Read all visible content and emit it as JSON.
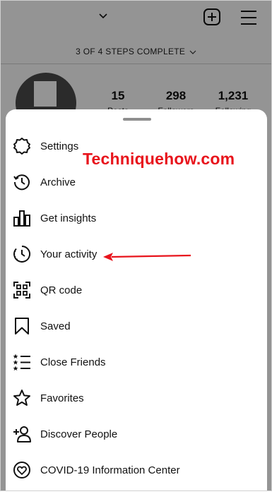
{
  "header": {
    "steps_text": "3 OF 4 STEPS COMPLETE"
  },
  "profile": {
    "stats": [
      {
        "value": "15",
        "label": "Posts"
      },
      {
        "value": "298",
        "label": "Followers"
      },
      {
        "value": "1,231",
        "label": "Following"
      }
    ]
  },
  "menu": {
    "items": [
      {
        "label": "Settings",
        "icon": "settings-gear-icon"
      },
      {
        "label": "Archive",
        "icon": "archive-clock-icon"
      },
      {
        "label": "Get insights",
        "icon": "insights-bar-chart-icon"
      },
      {
        "label": "Your activity",
        "icon": "activity-clock-icon"
      },
      {
        "label": "QR code",
        "icon": "qr-code-icon"
      },
      {
        "label": "Saved",
        "icon": "bookmark-icon"
      },
      {
        "label": "Close Friends",
        "icon": "close-friends-list-icon"
      },
      {
        "label": "Favorites",
        "icon": "star-icon"
      },
      {
        "label": "Discover People",
        "icon": "add-person-icon"
      },
      {
        "label": "COVID-19 Information Center",
        "icon": "covid-heart-icon"
      }
    ]
  },
  "watermark": {
    "text": "Techniquehow.com",
    "color": "#e8141c"
  },
  "annotation": {
    "arrow_color": "#e8141c"
  }
}
